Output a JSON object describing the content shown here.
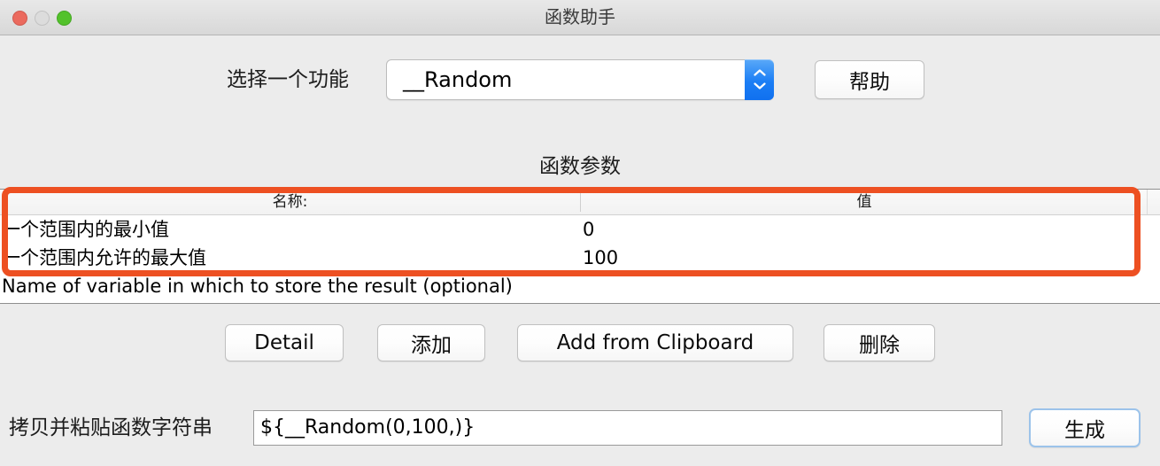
{
  "window": {
    "title": "函数助手",
    "traffic_lights": [
      {
        "name": "close",
        "color": "#eb6a5e"
      },
      {
        "name": "minimize",
        "color": "#dcdcdc"
      },
      {
        "name": "maximize",
        "color": "#53c22b"
      }
    ]
  },
  "selector": {
    "label": "选择一个功能",
    "value": "__Random",
    "stepper_icon": "chevron-up-down-icon",
    "stepper_color": "#1b7ef5"
  },
  "help_button": {
    "label": "帮助"
  },
  "params": {
    "heading": "函数参数",
    "columns": [
      "名称:",
      "值"
    ],
    "rows": [
      {
        "name": "一个范围内的最小值",
        "value": "0"
      },
      {
        "name": "一个范围内允许的最大值",
        "value": "100"
      },
      {
        "name": "Name of variable in which to store the result (optional)",
        "value": ""
      }
    ]
  },
  "annotation": {
    "color": "#ed5022"
  },
  "actions": {
    "detail": "Detail",
    "add": "添加",
    "add_from_clipboard": "Add from Clipboard",
    "delete": "删除"
  },
  "footer": {
    "label": "拷贝并粘贴函数字符串",
    "function_string": "${__Random(0,100,)}",
    "generate": "生成"
  }
}
